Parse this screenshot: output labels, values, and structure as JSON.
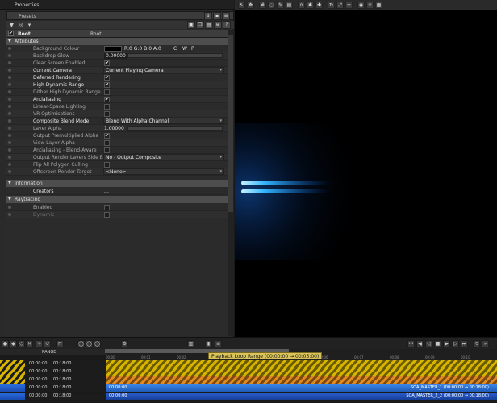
{
  "titlebar": {
    "title": "Properties"
  },
  "presets": {
    "label": "Presets"
  },
  "root": {
    "name": "Root",
    "type": "Root"
  },
  "sections": {
    "attributes": "Attributes",
    "information": "Information",
    "raytracing": "Raytracing"
  },
  "attributes": [
    {
      "name": "Background Colour",
      "kind": "color",
      "value": "R:0 G:0 B:0 A:0",
      "extra": [
        "C",
        "W",
        "P"
      ],
      "bold": false
    },
    {
      "name": "Backdrop Glow",
      "kind": "text",
      "value": "0.00000",
      "bold": false
    },
    {
      "name": "Clear Screen Enabled",
      "kind": "check",
      "value": "✔",
      "bold": false
    },
    {
      "name": "Current Camera",
      "kind": "dropdown",
      "value": "Current Playing Camera",
      "bold": true
    },
    {
      "name": "Deferred Rendering",
      "kind": "check",
      "value": "✔",
      "bold": true
    },
    {
      "name": "High Dynamic Range",
      "kind": "check",
      "value": "✔",
      "bold": true
    },
    {
      "name": "Dither High Dynamic Range",
      "kind": "check",
      "value": "",
      "bold": false
    },
    {
      "name": "Antialiasing",
      "kind": "check",
      "value": "✔",
      "bold": true
    },
    {
      "name": "Linear-Space Lighting",
      "kind": "check",
      "value": "",
      "bold": false
    },
    {
      "name": "VR Optimisations",
      "kind": "check",
      "value": "",
      "bold": false
    },
    {
      "name": "Composite Blend Mode",
      "kind": "dropdown",
      "value": "Blend With Alpha Channel",
      "bold": true
    },
    {
      "name": "Layer Alpha",
      "kind": "slider",
      "value": "1.00000",
      "bold": false
    },
    {
      "name": "Output Premultiplied Alpha",
      "kind": "check",
      "value": "✔",
      "bold": false
    },
    {
      "name": "View Layer Alpha",
      "kind": "check",
      "value": "",
      "bold": false
    },
    {
      "name": "Antialiasing - Blend-Aware",
      "kind": "check",
      "value": "",
      "bold": false
    },
    {
      "name": "Output Render Layers Side By Side",
      "kind": "dropdown",
      "value": "No - Output Composite",
      "bold": false
    },
    {
      "name": "Flip All Polygon Culling",
      "kind": "check",
      "value": "",
      "bold": false
    },
    {
      "name": "Offscreen Render Target",
      "kind": "dropdown",
      "value": "<None>",
      "bold": false
    }
  ],
  "information": [
    {
      "name": "Creators",
      "value": "..."
    }
  ],
  "raytracing": [
    {
      "name": "Enabled",
      "value": ""
    },
    {
      "name": "Dynamic",
      "value": ""
    }
  ],
  "timeline": {
    "range_label": "RANGE",
    "tooltip": "Playback Loop Range (00:00:00 → 00:05:00)",
    "ticks": [
      "00:00",
      "00:01",
      "00:02",
      "00:03",
      "00:04",
      "00:05",
      "00:06",
      "00:07",
      "00:08",
      "00:09",
      "00:10"
    ],
    "tracks": [
      {
        "start": "00:00:00",
        "end": "00:18:00",
        "clip": "",
        "clip_right": ""
      },
      {
        "start": "00:00:00",
        "end": "00:18:00",
        "clip": "",
        "clip_right": ""
      },
      {
        "start": "00:00:00",
        "end": "00:18:00",
        "clip": "",
        "clip_right": ""
      },
      {
        "start": "00:00:00",
        "end": "00:18:00",
        "clip": "00:00:00",
        "clip_right": "SOA_MASTER_1 (00:00:00 → 00:18:00)"
      },
      {
        "start": "00:00:00",
        "end": "00:18:00",
        "clip": "00:00:00",
        "clip_right": "SOA_MASTER_2_2 (00:00:00 → 00:18:00)"
      }
    ]
  },
  "colors": {
    "accent": "#d6b400",
    "clip_blue": "#1e6ae0",
    "beam": "#3fb2ff"
  }
}
